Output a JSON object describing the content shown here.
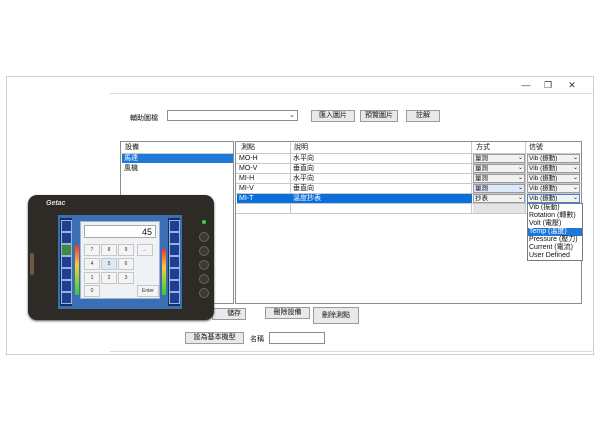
{
  "window_controls": {
    "minimize": "—",
    "restore": "❐",
    "close": "✕"
  },
  "toolbar": {
    "aux_label": "輔助圖檔",
    "aux_value": "",
    "import_btn": "匯入圖片",
    "preview_btn": "預覽圖片",
    "note_btn": "註解"
  },
  "equipment": {
    "header": "設備",
    "items": [
      "馬達",
      "風機"
    ],
    "selected": 0
  },
  "points": {
    "headers": [
      "測點",
      "說明",
      "方式",
      "信號"
    ],
    "rows": [
      {
        "point": "MO-H",
        "desc": "水平向",
        "method": "量測",
        "signal": "Vib (振動)"
      },
      {
        "point": "MO-V",
        "desc": "垂直向",
        "method": "量測",
        "signal": "Vib (振動)"
      },
      {
        "point": "MI-H",
        "desc": "水平向",
        "method": "量測",
        "signal": "Vib (振動)"
      },
      {
        "point": "MI-V",
        "desc": "垂直向",
        "method": "量測",
        "signal": "Vib (振動)"
      },
      {
        "point": "MI-T",
        "desc": "溫度抄表",
        "method": "抄表",
        "signal": "Vib (振動)"
      }
    ],
    "selected_row": 4
  },
  "signal_dropdown": {
    "options": [
      "Vib (振動)",
      "Rotation (轉數)",
      "Volt (電壓)",
      "Temp (溫度)",
      "Pressure (壓力)",
      "Current (電流)",
      "User Defined"
    ],
    "highlighted": 3
  },
  "buttons": {
    "save": "儲存",
    "delete_equipment": "刪除設備",
    "delete_point": "刪除測點",
    "set_base_model": "設為基本機型"
  },
  "name_field": {
    "label": "名稱",
    "value": ""
  },
  "tablet": {
    "brand": "Getac",
    "display_value": "45",
    "keys": [
      "7",
      "8",
      "9",
      "←",
      "4",
      "5",
      "6",
      "",
      "1",
      "2",
      "3",
      "0",
      "",
      "",
      "",
      "Enter"
    ]
  },
  "colors": {
    "selection": "#1e78d7",
    "highlight": "#0a6fd8",
    "tablet_screen": "#3b6fb3"
  }
}
